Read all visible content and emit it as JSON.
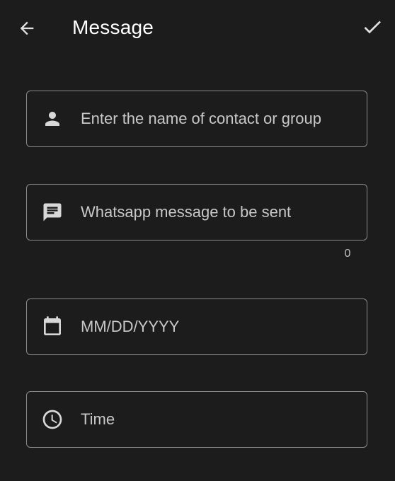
{
  "toolbar": {
    "title": "Message",
    "back_icon": "arrow-back-icon",
    "confirm_icon": "check-icon"
  },
  "form": {
    "contact": {
      "placeholder": "Enter the name of contact or group",
      "icon": "person-icon"
    },
    "message": {
      "placeholder": "Whatsapp message to be sent",
      "icon": "message-icon",
      "char_count": "0"
    },
    "date": {
      "placeholder": "MM/DD/YYYY",
      "icon": "calendar-icon"
    },
    "time": {
      "placeholder": "Time",
      "icon": "clock-icon"
    }
  },
  "colors": {
    "background": "#1c1c1c",
    "border": "#8a8a8a",
    "text": "#ffffff",
    "placeholder": "#c8c8c8"
  }
}
